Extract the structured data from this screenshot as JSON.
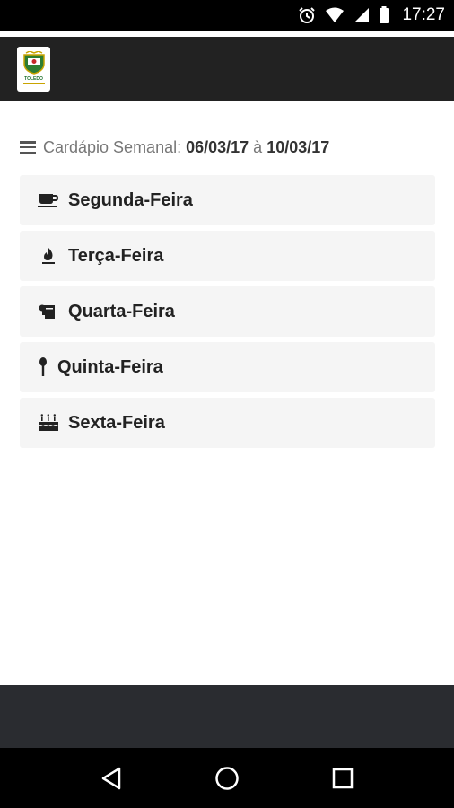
{
  "status_bar": {
    "time": "17:27",
    "icons": [
      "alarm-icon",
      "wifi-icon",
      "signal-icon",
      "battery-icon"
    ]
  },
  "app_bar": {
    "logo_text": "TOLEDO"
  },
  "heading": {
    "label": "Cardápio Semanal:",
    "start_date": "06/03/17",
    "separator": "à",
    "end_date": "10/03/17"
  },
  "days": [
    {
      "label": "Segunda-Feira",
      "icon": "coffee-cup-icon"
    },
    {
      "label": "Terça-Feira",
      "icon": "fire-icon"
    },
    {
      "label": "Quarta-Feira",
      "icon": "paper-roll-icon"
    },
    {
      "label": "Quinta-Feira",
      "icon": "spoon-icon"
    },
    {
      "label": "Sexta-Feira",
      "icon": "birthday-cake-icon"
    }
  ],
  "nav_bar": {
    "icons": [
      "back-icon",
      "home-icon",
      "recents-icon"
    ]
  },
  "colors": {
    "app_bar_bg": "#222222",
    "footer_bg": "#2a2c30",
    "card_bg": "#f5f5f5"
  }
}
